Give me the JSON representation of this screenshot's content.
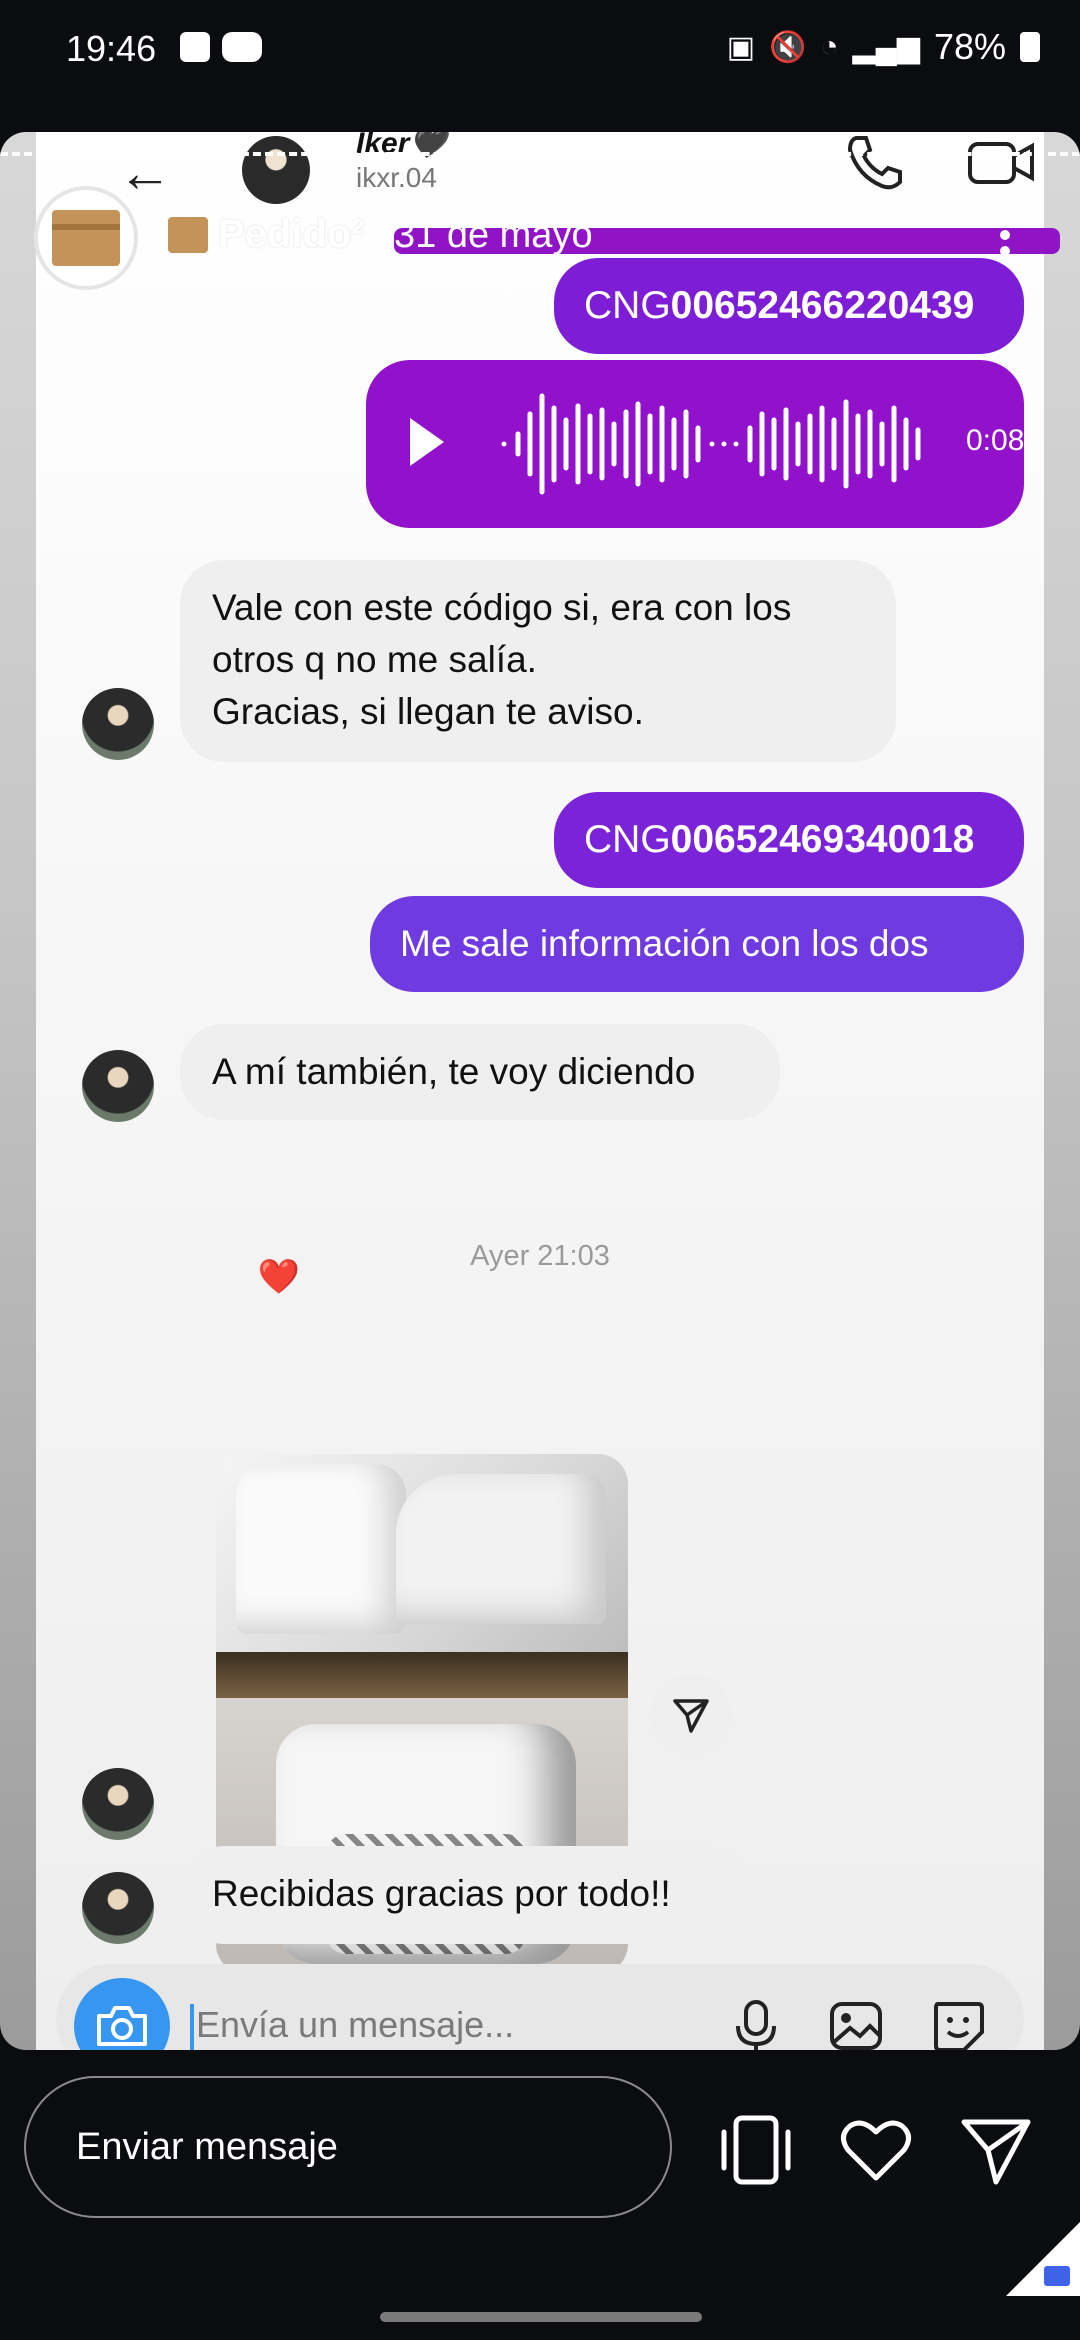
{
  "status_bar": {
    "time": "19:46",
    "battery": "78%"
  },
  "chat_header": {
    "contact_name": "Iker🖤",
    "username": "ikxr.04"
  },
  "story_header": {
    "brand_name": "Pedido²",
    "date": "31 de mayo"
  },
  "messages": {
    "code1": {
      "prefix": "CNG",
      "number": "00652466220439"
    },
    "voice_note": {
      "duration": "0:08"
    },
    "reply1": [
      "Vale con este código si, era con los",
      "otros q no me salía.",
      "Gracias, si llegan te aviso."
    ],
    "code2": {
      "prefix": "CNG",
      "number": "00652469340018"
    },
    "sent_text": "Me sale información con los dos",
    "reply2": "A mí también, te voy diciendo",
    "reaction": "❤️",
    "timestamp": "Ayer 21:03",
    "reply3": "Recibidas gracias por todo!!"
  },
  "composer": {
    "placeholder": "Envía un mensaje..."
  },
  "reply_bar": {
    "placeholder": "Enviar mensaje"
  },
  "icons": [
    "back-arrow-icon",
    "phone-icon",
    "video-call-icon",
    "more-options-icon",
    "play-icon",
    "share-icon",
    "camera-icon",
    "microphone-icon",
    "gallery-icon",
    "sticker-icon",
    "phone-frame-icon",
    "heart-icon",
    "send-icon"
  ],
  "colors": {
    "voice_bubble": "#9212CB",
    "code_bubble": "#7E1DD6",
    "text_bubble": "#6F3BE1",
    "received_bubble": "#EFEFEF",
    "camera_button": "#3797F0"
  }
}
